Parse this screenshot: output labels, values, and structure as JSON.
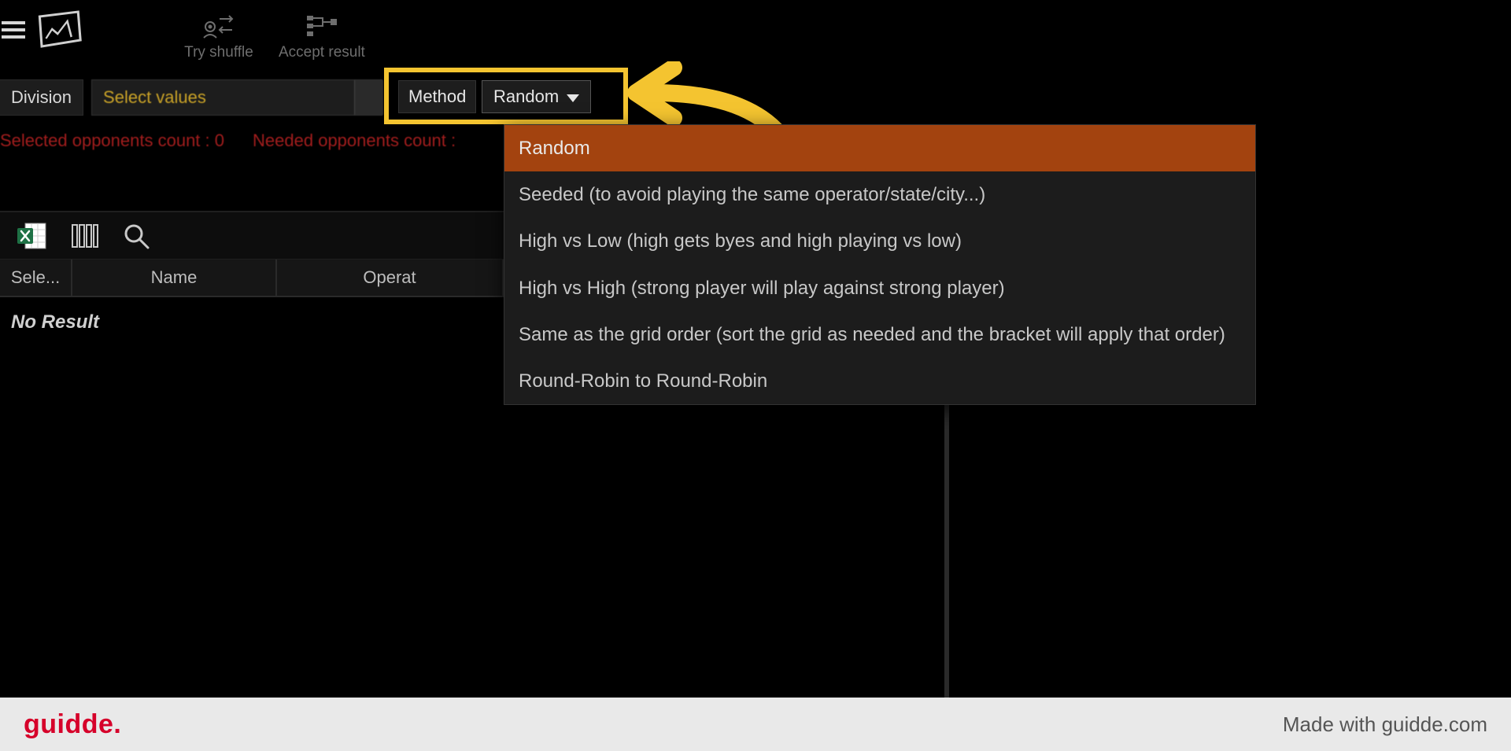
{
  "toolbar": {
    "try_shuffle_label": "Try shuffle",
    "accept_result_label": "Accept result"
  },
  "controls": {
    "division_label": "Division",
    "division_placeholder": "Select values",
    "method_label": "Method",
    "method_value": "Random"
  },
  "status": {
    "selected_label": "Selected opponents count :",
    "selected_value": "0",
    "needed_label": "Needed opponents count :"
  },
  "dropdown": {
    "options": [
      "Random",
      "Seeded (to avoid playing the same operator/state/city...)",
      "High vs Low (high gets byes and high playing vs low)",
      "High vs High (strong player will play against strong player)",
      "Same as the grid order (sort the grid as needed and the bracket will apply that order)",
      "Round-Robin to Round-Robin"
    ],
    "selected_index": 0
  },
  "grid": {
    "columns": {
      "select": "Sele...",
      "name": "Name",
      "operator": "Operat"
    },
    "no_result": "No Result"
  },
  "footer": {
    "logo": "guidde.",
    "made_with": "Made with guidde.com"
  },
  "colors": {
    "highlight": "#f4c430",
    "dropdown_selected_bg": "#a3430f",
    "status_text": "#a11d1d",
    "footer_logo": "#d6002a"
  }
}
